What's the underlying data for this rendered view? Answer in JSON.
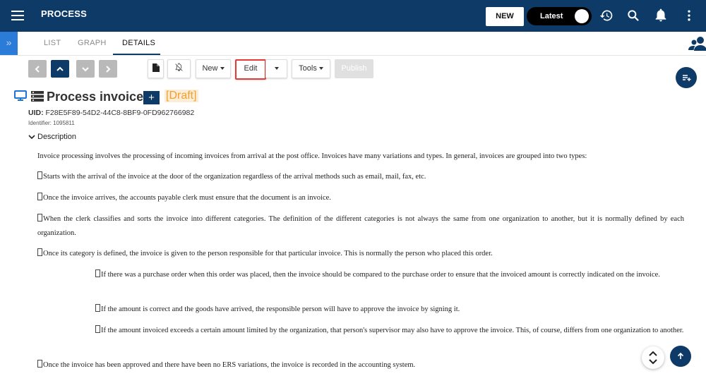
{
  "header": {
    "title": "PROCESS",
    "new_label": "NEW",
    "toggle_label": "Latest",
    "icons": [
      "menu-icon",
      "history-icon",
      "search-icon",
      "bell-icon",
      "more-vert-icon"
    ]
  },
  "tabs": [
    {
      "label": "LIST"
    },
    {
      "label": "GRAPH"
    },
    {
      "label": "DETAILS"
    }
  ],
  "toolbar": {
    "new_label": "New",
    "edit_label": "Edit",
    "tools_label": "Tools",
    "publish_label": "Publish"
  },
  "item": {
    "title": "Process invoice",
    "add_glyph": "+",
    "status": "[Draft]",
    "uid_label": "UID:",
    "uid_value": "F28E5F89-54D2-44C8-8BF9-0FD962766982",
    "identifier": "Identifier:  1095811",
    "description_label": "Description"
  },
  "description": {
    "intro": "Invoice processing involves the processing of incoming invoices from arrival at the post office. Invoices have many variations and types. In general, invoices are grouped into two types:",
    "p1": "Starts with the arrival of the invoice at the door of the organization regardless of the arrival methods such as email, mail, fax, etc.",
    "p2": "Once the invoice arrives, the accounts payable clerk must ensure that the document is an invoice.",
    "p3": "When the clerk classifies and sorts the invoice into different categories. The definition of the different categories is not always the same from one organization to another, but it is normally defined by each organization.",
    "p4": "Once its category is defined, the invoice is given to the person responsible for that particular invoice. This is normally the person who placed this order.",
    "s1": "If there was a purchase order when this order was placed, then the invoice should be compared to the purchase order to ensure that the invoiced amount is correctly indicated on the invoice.",
    "s2": "If the amount is correct and the goods have arrived, the responsible person will have to approve the invoice by signing it.",
    "s3": "If the amount invoiced exceeds a certain amount limited by the organization, that person's supervisor may also have to approve the invoice. This, of course, differs from one organization to another.",
    "p5": "Once the invoice has been approved and there have been no ERS variations, the invoice is recorded in the accounting system."
  }
}
